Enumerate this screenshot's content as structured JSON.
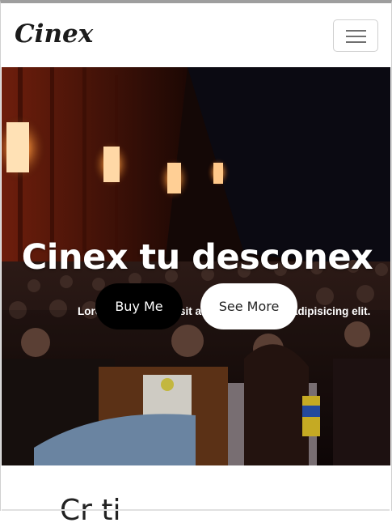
{
  "navbar": {
    "brand": "Cinex",
    "menu_icon": "hamburger-menu-icon"
  },
  "hero": {
    "title": "Cinex tu desconex",
    "subtitle": "Lorem ipsum dolor sit amet, consectetur adipisicing elit.",
    "buy_label": "Buy Me",
    "more_label": "See More",
    "background": "cinema-audience-photo"
  },
  "section": {
    "heading_partial": "Cr      ti"
  },
  "colors": {
    "brand_text": "#1b1b1b",
    "primary_button": "#000000",
    "secondary_button": "#ffffff",
    "hero_text": "#ffffff"
  }
}
